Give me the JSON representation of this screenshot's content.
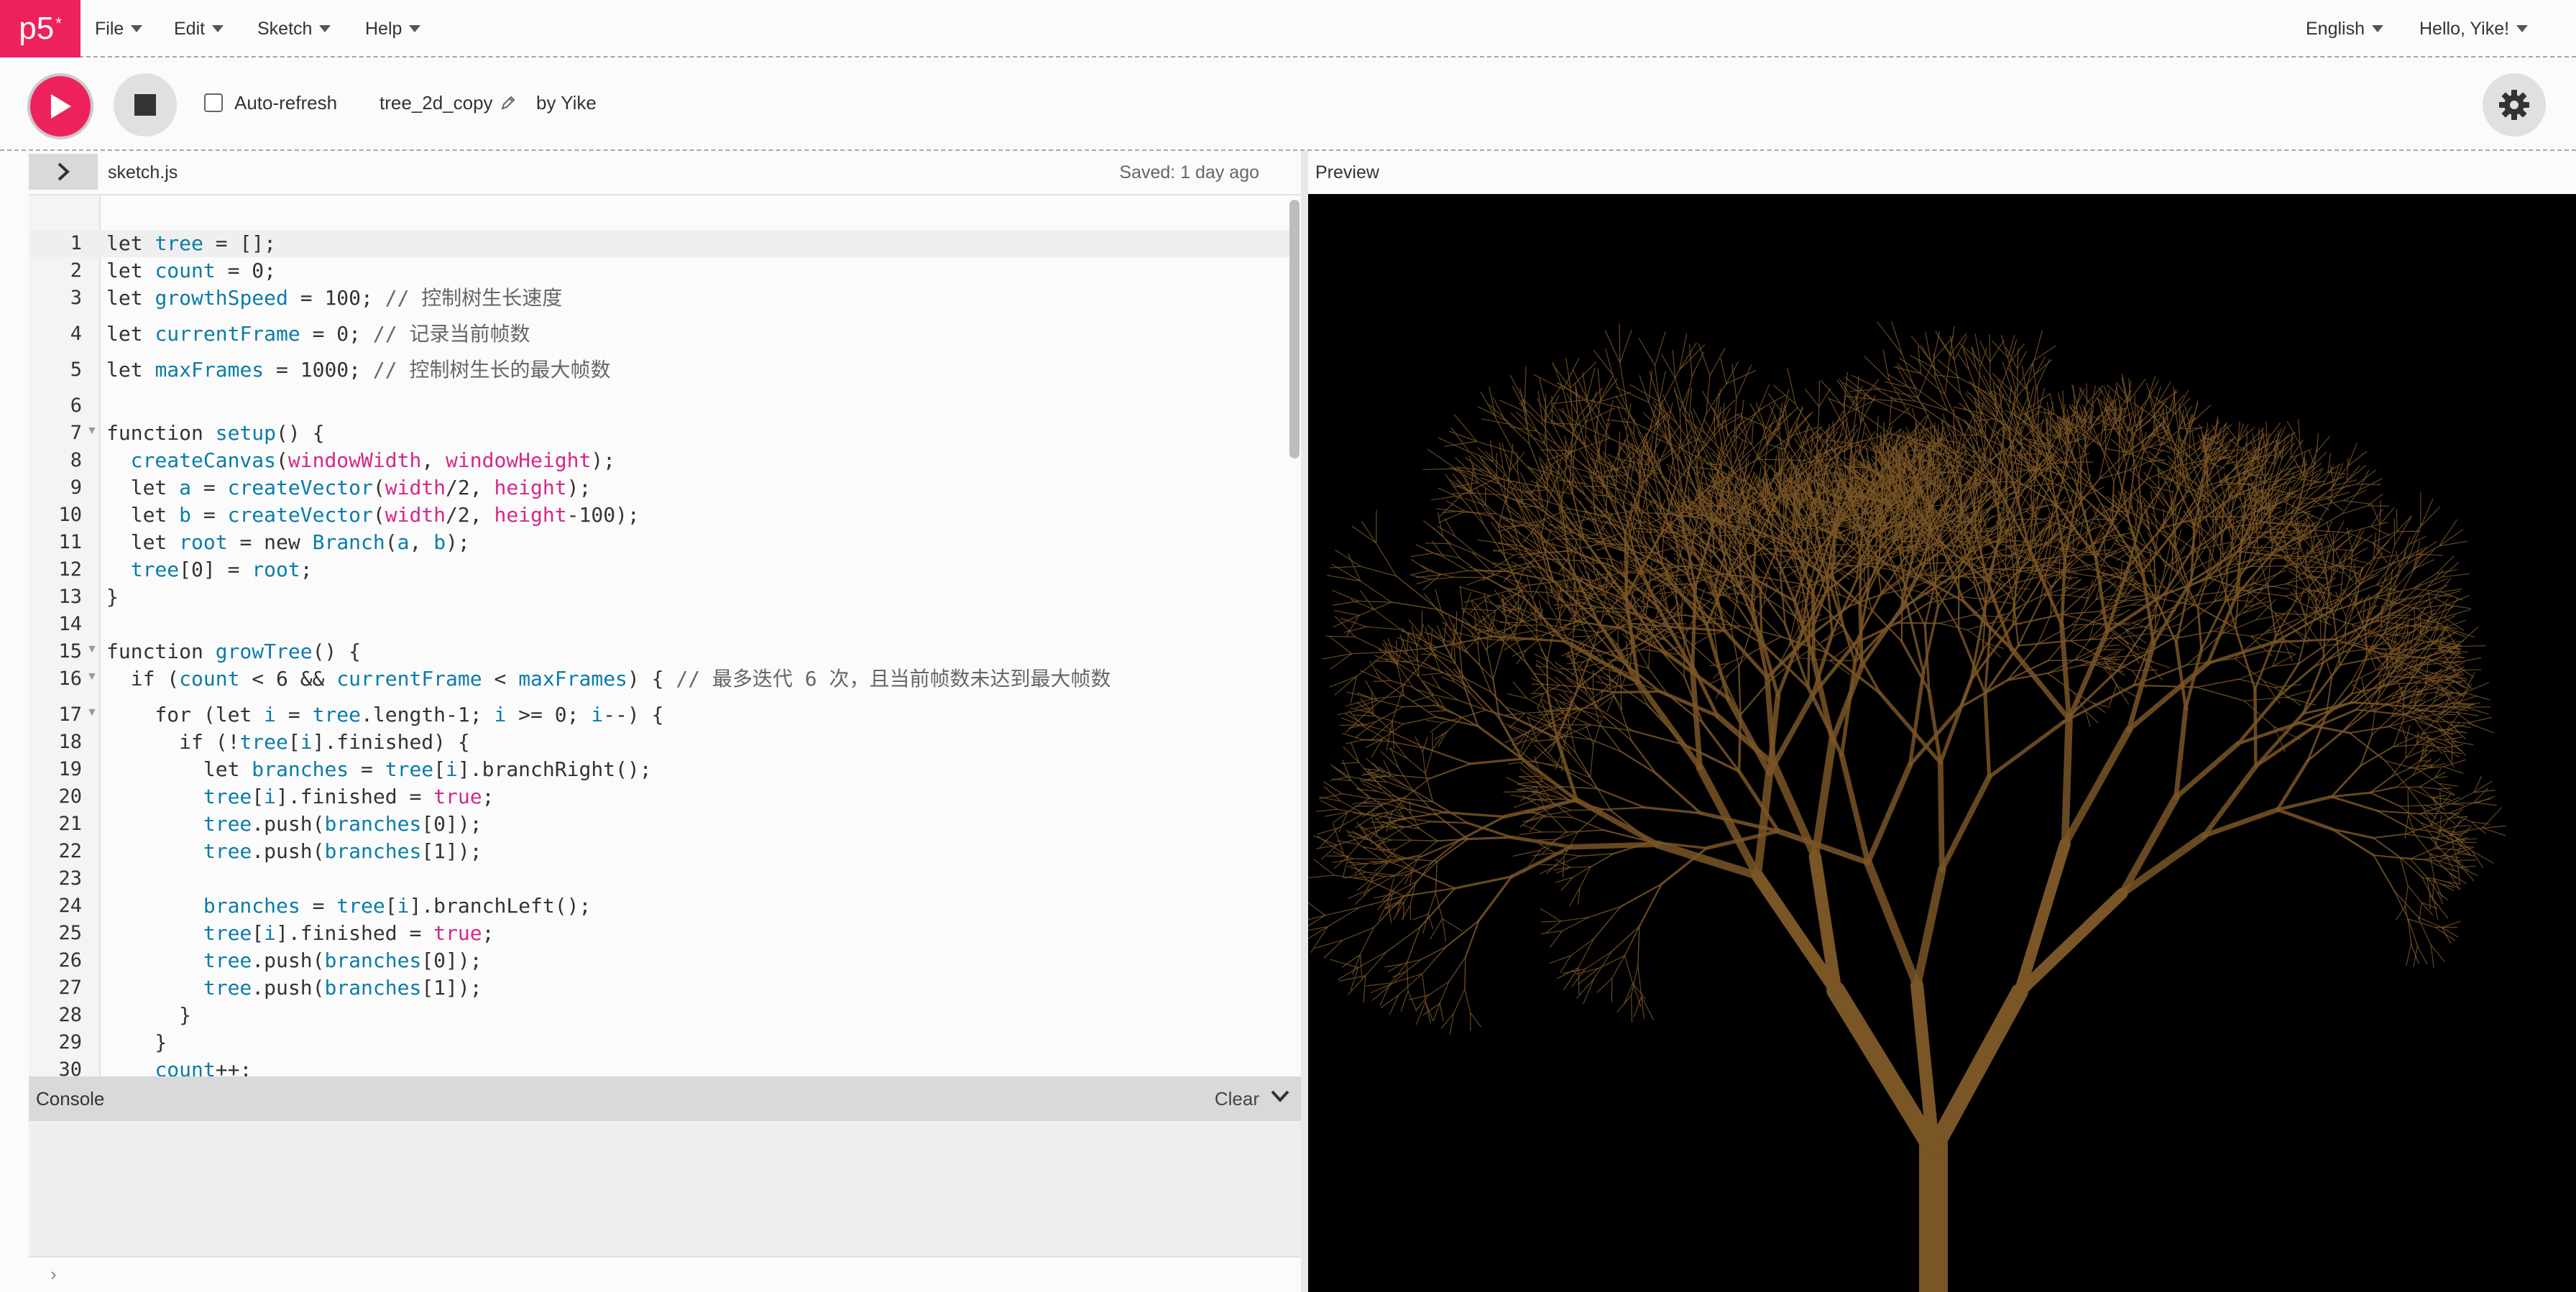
{
  "nav": {
    "logo": "p5",
    "logo_sup": "*",
    "menus": [
      "File",
      "Edit",
      "Sketch",
      "Help"
    ],
    "language": "English",
    "user": "Hello, Yike!"
  },
  "toolbar": {
    "auto_refresh_label": "Auto-refresh",
    "sketch_name": "tree_2d_copy",
    "author": "by Yike"
  },
  "editor": {
    "file_name": "sketch.js",
    "saved_status": "Saved: 1 day ago",
    "preview_label": "Preview",
    "lines": [
      "let tree = [];",
      "let count = 0;",
      "let growthSpeed = 100; // 控制树生长速度",
      "let currentFrame = 0; // 记录当前帧数",
      "let maxFrames = 1000; // 控制树生长的最大帧数",
      "",
      "function setup() {",
      "  createCanvas(windowWidth, windowHeight);",
      "  let a = createVector(width/2, height);",
      "  let b = createVector(width/2, height-100);",
      "  let root = new Branch(a, b);",
      "  tree[0] = root;",
      "}",
      "",
      "function growTree() {",
      "  if (count < 6 && currentFrame < maxFrames) { // 最多迭代 6 次，且当前帧数未达到最大帧数",
      "    for (let i = tree.length-1; i >= 0; i--) {",
      "      if (!tree[i].finished) {",
      "        let branches = tree[i].branchRight();",
      "        tree[i].finished = true;",
      "        tree.push(branches[0]);",
      "        tree.push(branches[1]);",
      "",
      "        branches = tree[i].branchLeft();",
      "        tree[i].finished = true;",
      "        tree.push(branches[0]);",
      "        tree.push(branches[1]);",
      "      }",
      "    }",
      "    count++;"
    ]
  },
  "console": {
    "title": "Console",
    "clear_label": "Clear"
  },
  "colors": {
    "accent": "#ed225d",
    "branch": "#7a5526",
    "preview_bg": "#000000"
  }
}
